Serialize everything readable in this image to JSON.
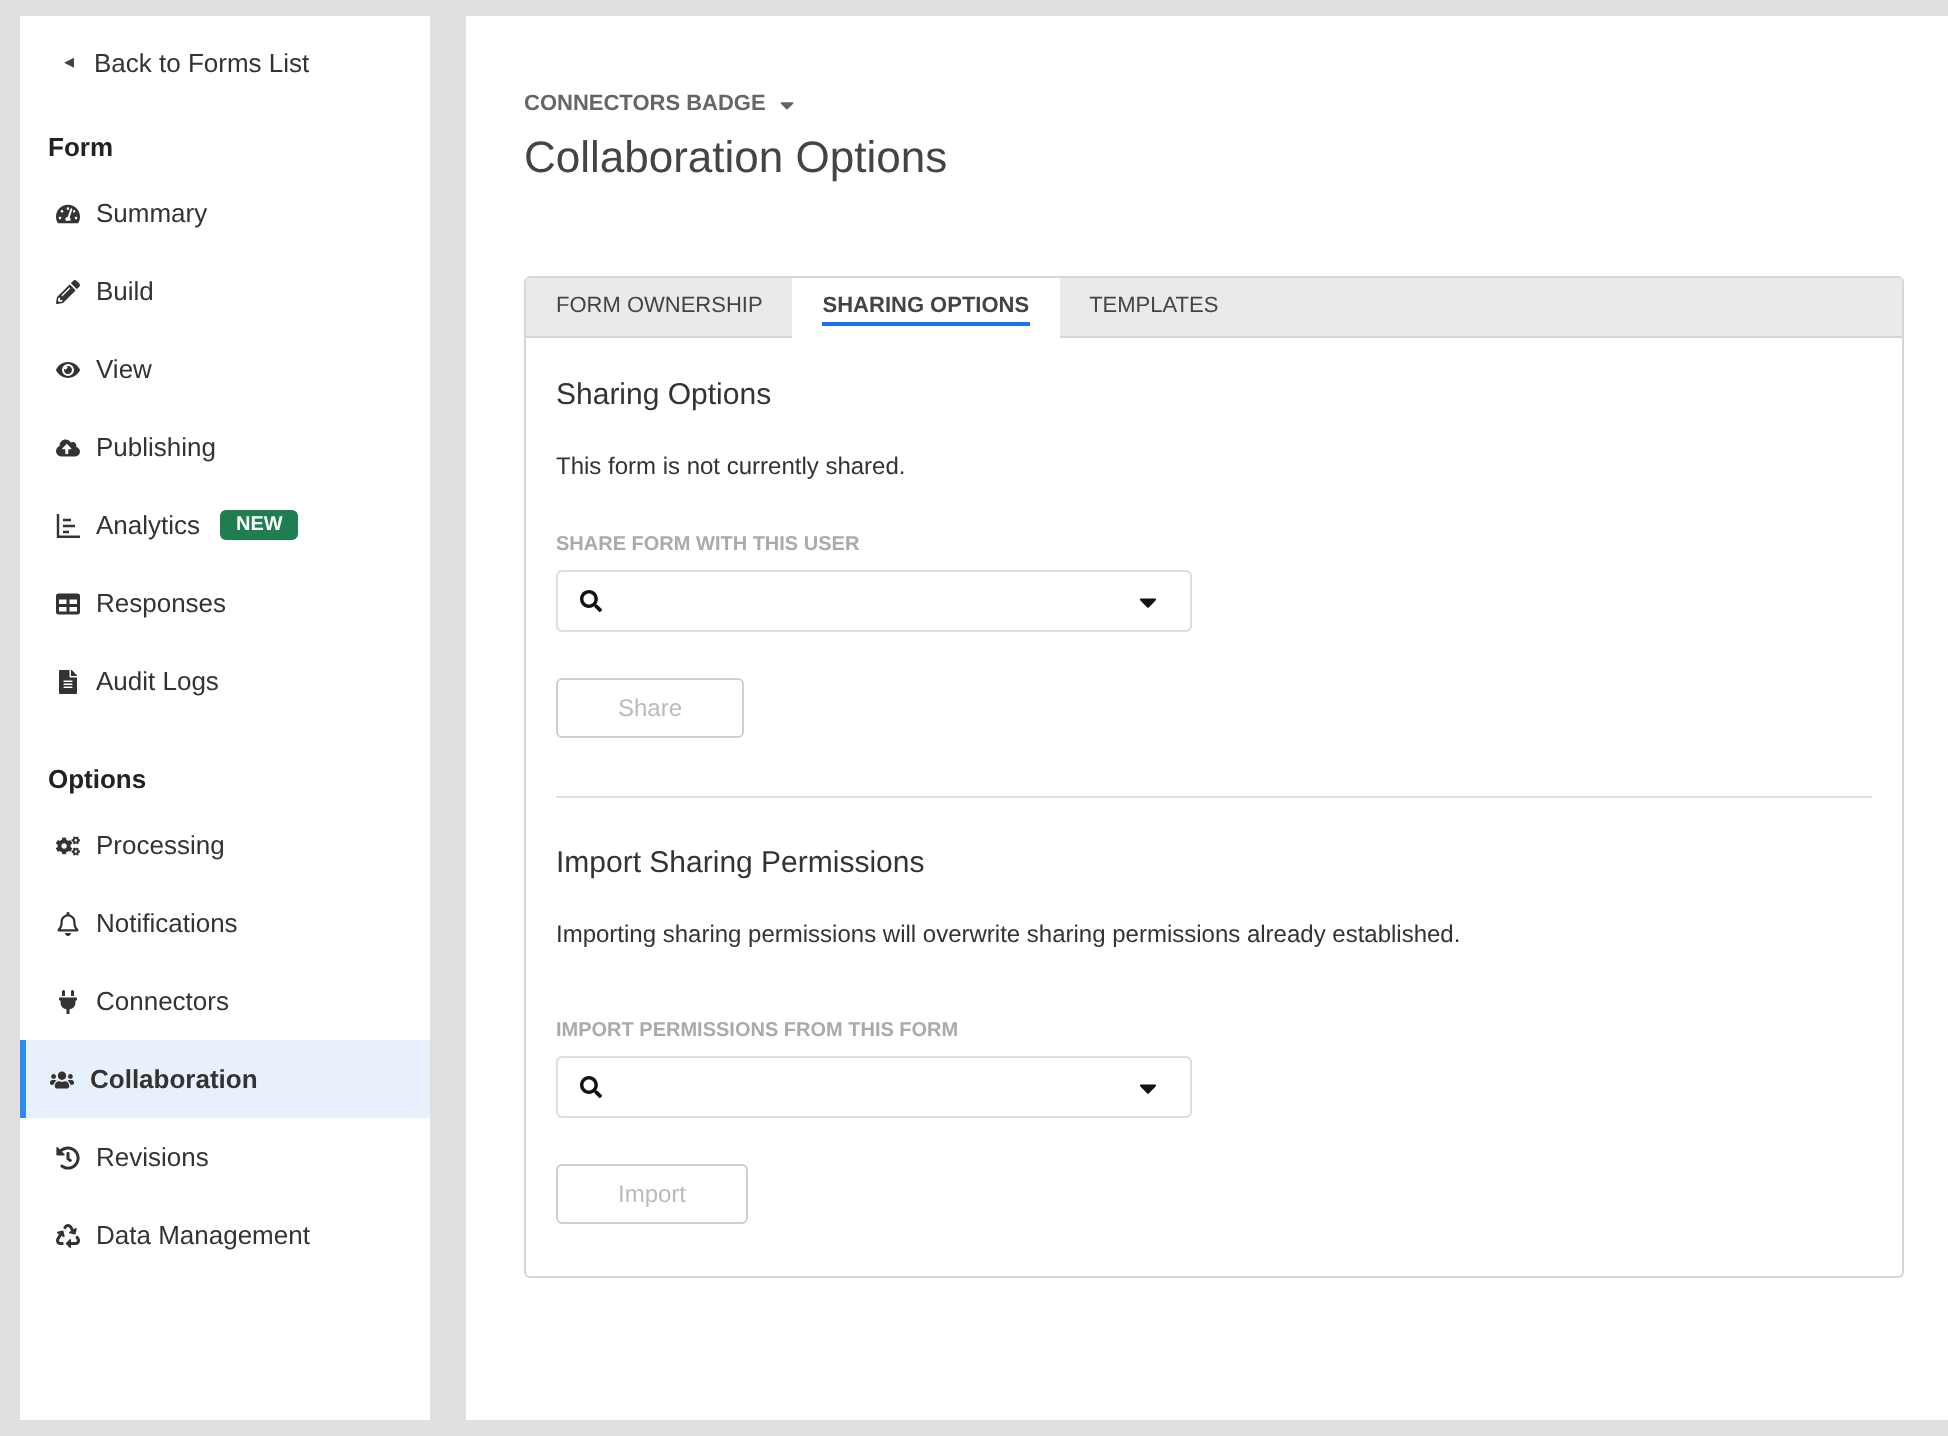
{
  "sidebar": {
    "back_link": {
      "arrow": "◂",
      "label": "Back to Forms List"
    },
    "sections": [
      {
        "heading": "Form",
        "items": [
          {
            "label": "Summary",
            "selected": false
          },
          {
            "label": "Build",
            "selected": false
          },
          {
            "label": "View",
            "selected": false
          },
          {
            "label": "Publishing",
            "selected": false
          },
          {
            "label": "Analytics",
            "selected": false,
            "badge": "NEW"
          },
          {
            "label": "Responses",
            "selected": false
          },
          {
            "label": "Audit Logs",
            "selected": false
          }
        ]
      },
      {
        "heading": "Options",
        "items": [
          {
            "label": "Processing",
            "selected": false
          },
          {
            "label": "Notifications",
            "selected": false
          },
          {
            "label": "Connectors",
            "selected": false
          },
          {
            "label": "Collaboration",
            "selected": true
          },
          {
            "label": "Revisions",
            "selected": false
          },
          {
            "label": "Data Management",
            "selected": false
          }
        ]
      }
    ]
  },
  "header": {
    "form_name": "CONNECTORS BADGE",
    "title": "Collaboration Options"
  },
  "tabs": [
    {
      "label": "FORM OWNERSHIP",
      "selected": false
    },
    {
      "label": "SHARING OPTIONS",
      "selected": true
    },
    {
      "label": "TEMPLATES",
      "selected": false
    }
  ],
  "sections": [
    {
      "heading": "Sharing Options",
      "text": "This form is not currently shared.",
      "field_label": "SHARE FORM WITH THIS USER",
      "button": {
        "label": "Share",
        "disabled": true
      }
    },
    {
      "heading": "Import Sharing Permissions",
      "text": "Importing sharing permissions will overwrite sharing permissions already established.",
      "field_label": "IMPORT PERMISSIONS FROM THIS FORM",
      "button": {
        "label": "Import",
        "disabled": true
      }
    }
  ]
}
